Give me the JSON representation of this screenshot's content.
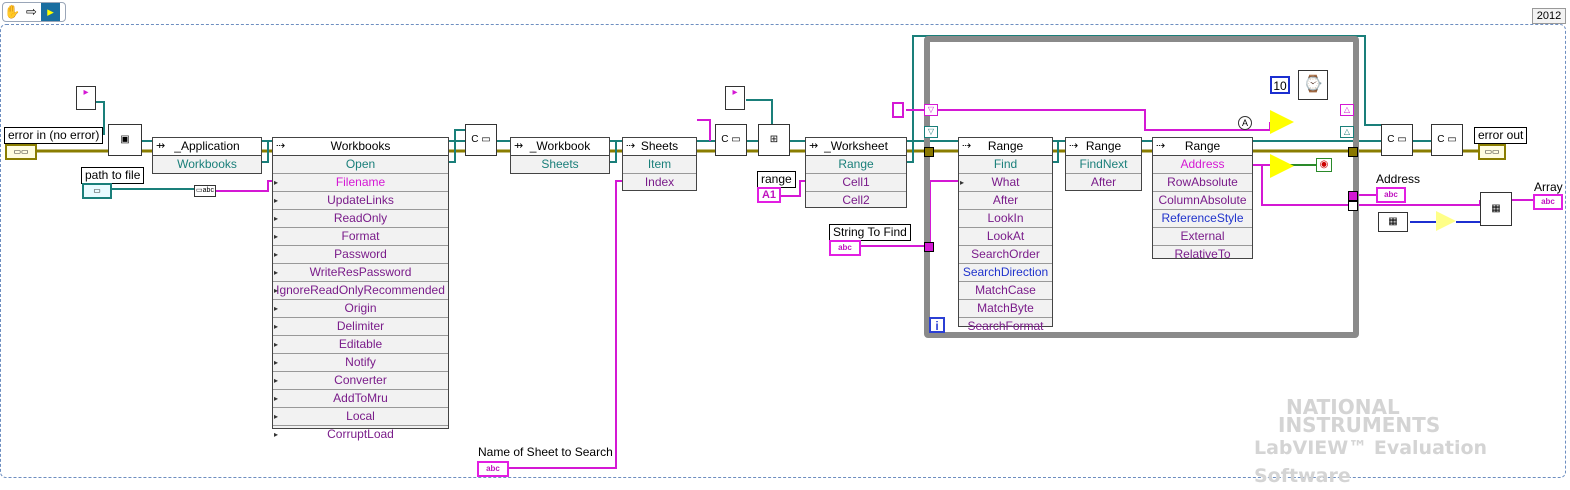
{
  "toolbar": {
    "icons": [
      "hand-icon",
      "run-arrow-icon",
      "vi-icon"
    ]
  },
  "version": "2012",
  "terminals": {
    "error_in": "error in (no error)",
    "error_out": "error out",
    "path_to_file": "path to file",
    "range": "range",
    "range_value": "A1",
    "string_to_find": "String To Find",
    "sheet_name": "Name of Sheet to Search",
    "address": "Address",
    "array": "Array",
    "abc": "abc",
    "numeric_const": "10",
    "iteration": "i"
  },
  "nodes": {
    "application": {
      "title": "_Application",
      "rows": [
        "Workbooks"
      ]
    },
    "workbooks": {
      "title": "Workbooks",
      "rows": [
        "Open",
        "Filename",
        "UpdateLinks",
        "ReadOnly",
        "Format",
        "Password",
        "WriteResPassword",
        "IgnoreReadOnlyRecommended",
        "Origin",
        "Delimiter",
        "Editable",
        "Notify",
        "Converter",
        "AddToMru",
        "Local",
        "CorruptLoad"
      ]
    },
    "workbook": {
      "title": "_Workbook",
      "rows": [
        "Sheets"
      ]
    },
    "sheets": {
      "title": "Sheets",
      "rows": [
        "Item",
        "Index"
      ]
    },
    "worksheet": {
      "title": "_Worksheet",
      "rows": [
        "Range",
        "Cell1",
        "Cell2"
      ]
    },
    "range_find": {
      "title": "Range",
      "rows": [
        "Find",
        "What",
        "After",
        "LookIn",
        "LookAt",
        "SearchOrder",
        "SearchDirection",
        "MatchCase",
        "MatchByte",
        "SearchFormat"
      ]
    },
    "range_findnext": {
      "title": "Range",
      "rows": [
        "FindNext",
        "After"
      ]
    },
    "range_address": {
      "title": "Range",
      "rows": [
        "Address",
        "RowAbsolute",
        "ColumnAbsolute",
        "ReferenceStyle",
        "External",
        "RelativeTo"
      ]
    }
  },
  "watermark": {
    "line1": "NATIONAL",
    "line2": "INSTRUMENTS",
    "line3": "LabVIEW™ Evaluation Software"
  }
}
